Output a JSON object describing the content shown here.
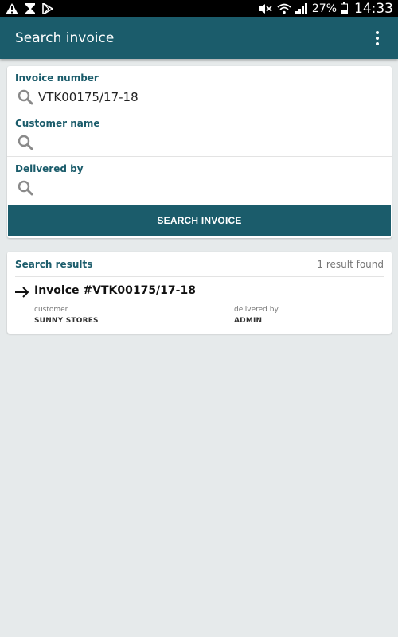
{
  "status_bar": {
    "battery_percent": "27%",
    "time": "14:33",
    "icons": [
      "warning-icon",
      "hourglass-icon",
      "play-store-icon",
      "mute-icon",
      "wifi-icon",
      "signal-icon",
      "battery-icon"
    ]
  },
  "app_bar": {
    "title": "Search invoice",
    "overflow_icon": "more-vert-icon"
  },
  "search_form": {
    "invoice_number": {
      "label": "Invoice number",
      "value": "VTK00175/17-18",
      "placeholder": ""
    },
    "customer_name": {
      "label": "Customer name",
      "value": "",
      "placeholder": ""
    },
    "delivered_by": {
      "label": "Delivered by",
      "value": "",
      "placeholder": ""
    },
    "search_button_label": "SEARCH INVOICE"
  },
  "results": {
    "title": "Search results",
    "count_text": "1 result found",
    "items": [
      {
        "title": "Invoice #VTK00175/17-18",
        "customer_label": "customer",
        "customer_value": "SUNNY STORES",
        "delivered_label": "delivered by",
        "delivered_value": "ADMIN"
      }
    ]
  },
  "colors": {
    "primary": "#1b5c6b",
    "background": "#e6eaeb",
    "status_bar": "#000000"
  }
}
